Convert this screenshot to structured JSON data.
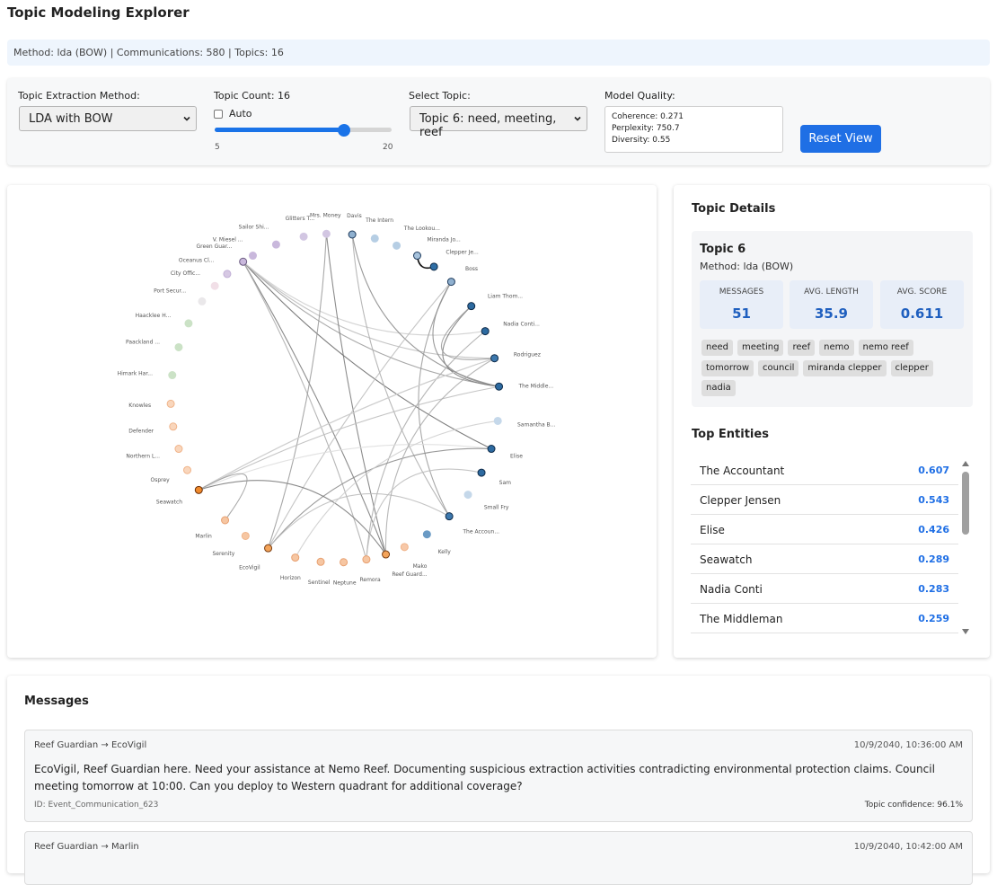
{
  "app": {
    "title": "Topic Modeling Explorer",
    "info": "Method: lda (BOW) | Communications: 580 | Topics: 16"
  },
  "controls": {
    "method_label": "Topic Extraction Method:",
    "method_value": "LDA with BOW",
    "count_label": "Topic Count: 16",
    "auto_label": "Auto",
    "auto_checked": false,
    "slider_min": "5",
    "slider_max": "20",
    "slider_value": 16,
    "topic_label": "Select Topic:",
    "topic_value": "Topic 6: need, meeting, reef",
    "quality_label": "Model Quality:",
    "coherence": "Coherence: 0.271",
    "perplexity": "Perplexity: 750.7",
    "diversity": "Diversity: 0.55",
    "reset_label": "Reset View"
  },
  "graph": {
    "nodes": [
      "V. Miesel ...",
      "Sailor Shi...",
      "Glitters T...",
      "Mrs. Money",
      "Davis",
      "The Intern",
      "The Lookou...",
      "Miranda Jo...",
      "Clepper Je...",
      "Boss",
      "Liam Thom...",
      "Nadia Conti...",
      "Rodriguez",
      "The Middle...",
      "Samantha B...",
      "Elise",
      "Sam",
      "Small Fry",
      "The Accoun...",
      "Kelly",
      "Mako",
      "Reef Guard...",
      "Remora",
      "Neptune",
      "Sentinel",
      "Horizon",
      "EcoVigil",
      "Serenity",
      "Marlin",
      "Seawatch",
      "Osprey",
      "Northern L...",
      "Defender",
      "Knowles",
      "Himark Har...",
      "Paackland ...",
      "Haacklee H...",
      "Port Secur...",
      "City Offic...",
      "Oceanus Cl...",
      "Green Guar..."
    ]
  },
  "details": {
    "title": "Topic Details",
    "topic_name": "Topic 6",
    "method": "Method: lda (BOW)",
    "stats": [
      {
        "label": "MESSAGES",
        "value": "51"
      },
      {
        "label": "AVG. LENGTH",
        "value": "35.9"
      },
      {
        "label": "AVG. SCORE",
        "value": "0.611"
      }
    ],
    "keywords": [
      "need",
      "meeting",
      "reef",
      "nemo",
      "nemo reef",
      "tomorrow",
      "council",
      "miranda clepper",
      "clepper",
      "nadia"
    ],
    "entities_title": "Top Entities",
    "entities": [
      {
        "name": "The Accountant",
        "score": "0.607"
      },
      {
        "name": "Clepper Jensen",
        "score": "0.543"
      },
      {
        "name": "Elise",
        "score": "0.426"
      },
      {
        "name": "Seawatch",
        "score": "0.289"
      },
      {
        "name": "Nadia Conti",
        "score": "0.283"
      },
      {
        "name": "The Middleman",
        "score": "0.259"
      }
    ]
  },
  "messages": {
    "title": "Messages",
    "items": [
      {
        "from": "Reef Guardian → EcoVigil",
        "time": "10/9/2040, 10:36:00 AM",
        "body": "EcoVigil, Reef Guardian here. Need your assistance at Nemo Reef. Documenting suspicious extraction activities contradicting environmental protection claims. Council meeting tomorrow at 10:00. Can you deploy to Western quadrant for additional coverage?",
        "id": "ID: Event_Communication_623",
        "confidence": "Topic confidence: 96.1%"
      },
      {
        "from": "Reef Guardian → Marlin",
        "time": "10/9/2040, 10:42:00 AM"
      }
    ]
  }
}
